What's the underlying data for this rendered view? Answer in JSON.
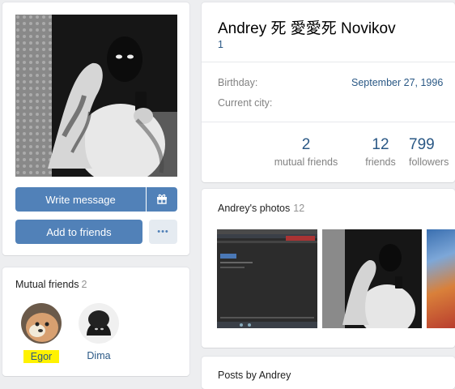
{
  "profile": {
    "name": "Andrey 死 愛愛死 Novikov",
    "status": "1",
    "fields": [
      {
        "label": "Birthday:",
        "value": "September 27, 1996"
      },
      {
        "label": "Current city:",
        "value": ""
      }
    ],
    "counters": [
      {
        "num": "2",
        "label": "mutual friends"
      },
      {
        "num": "12",
        "label": "friends"
      },
      {
        "num": "799",
        "label": "followers"
      }
    ]
  },
  "actions": {
    "write_message": "Write message",
    "add_to_friends": "Add to friends",
    "more_label": "•••",
    "gift_icon": "gift-icon"
  },
  "mutual": {
    "title": "Mutual friends",
    "count": "2",
    "friends": [
      {
        "name": "Egor"
      },
      {
        "name": "Dima"
      }
    ]
  },
  "photos": {
    "title": "Andrey's photos",
    "count": "12"
  },
  "posts": {
    "title": "Posts by Andrey"
  },
  "colors": {
    "accent": "#5181b8",
    "link": "#2a5885",
    "highlight": "#fff200"
  }
}
